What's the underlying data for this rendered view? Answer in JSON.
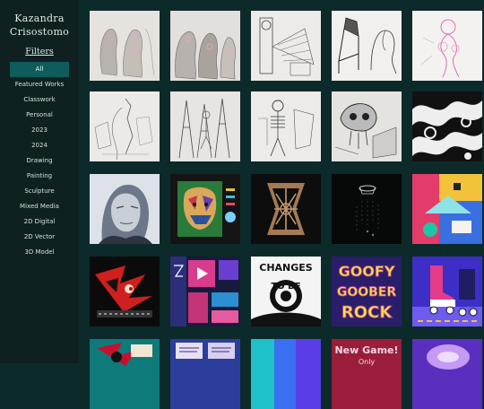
{
  "site": {
    "title_line1": "Kazandra",
    "title_line2": "Crisostomo"
  },
  "filters": {
    "heading": "Filters",
    "items": [
      {
        "label": "All",
        "active": true
      },
      {
        "label": "Featured Works"
      },
      {
        "label": "Classwork"
      },
      {
        "label": "Personal"
      },
      {
        "label": "2023"
      },
      {
        "label": "2024"
      },
      {
        "label": "Drawing"
      },
      {
        "label": "Painting"
      },
      {
        "label": "Sculpture"
      },
      {
        "label": "Mixed Media"
      },
      {
        "label": "2D Digital"
      },
      {
        "label": "2D Vector"
      },
      {
        "label": "3D Model"
      }
    ]
  },
  "gallery": {
    "tiles": [
      {
        "theme": "sketch-figures"
      },
      {
        "theme": "sketch-figures-2"
      },
      {
        "theme": "sketch-clock"
      },
      {
        "theme": "sketch-chair"
      },
      {
        "theme": "sketch-pink"
      },
      {
        "theme": "pencil-mannequin"
      },
      {
        "theme": "pencil-easels"
      },
      {
        "theme": "pencil-skeleton"
      },
      {
        "theme": "pencil-skull"
      },
      {
        "theme": "bw-pattern"
      },
      {
        "theme": "portrait-gray"
      },
      {
        "theme": "portrait-color"
      },
      {
        "theme": "3d-lattice"
      },
      {
        "theme": "3d-dark"
      },
      {
        "theme": "abstract-color"
      },
      {
        "theme": "character-red"
      },
      {
        "theme": "vector-collage"
      },
      {
        "theme": "typography-changes"
      },
      {
        "theme": "typography-goofy"
      },
      {
        "theme": "skates"
      },
      {
        "theme": "character-teal"
      },
      {
        "theme": "poster-text"
      },
      {
        "theme": "blue-shapes"
      },
      {
        "theme": "new-game"
      },
      {
        "theme": "purple-glow"
      }
    ],
    "texts": {
      "changes": "CHANGES",
      "tobe": "TO BE",
      "goofy": "GOOFY",
      "goober": "GOOBER",
      "rock": "ROCK",
      "newgame": "New Game!",
      "only": "Only"
    }
  }
}
